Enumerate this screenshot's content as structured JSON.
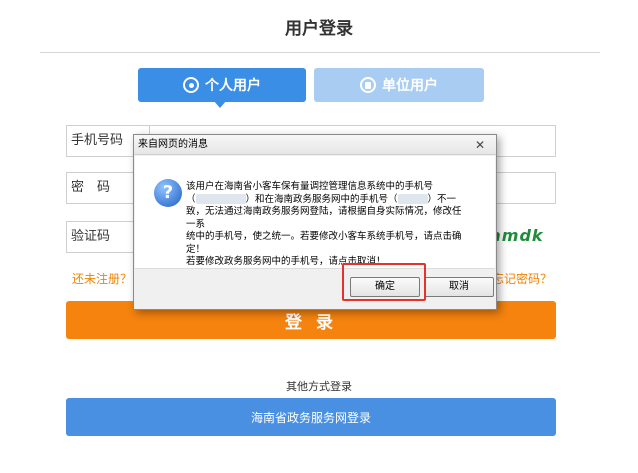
{
  "page": {
    "title": "用户登录"
  },
  "tabs": [
    {
      "label": "个人用户",
      "active": true,
      "icon": "user-icon"
    },
    {
      "label": "单位用户",
      "active": false,
      "icon": "building-icon"
    }
  ],
  "form": {
    "phone_label": "手机号码",
    "password_label": "密　码",
    "captcha_label": "验证码",
    "captcha_text": "amdk",
    "register_link": "还未注册？",
    "forgot_link": "忘记密码？",
    "login_button": "登 录"
  },
  "other_login": {
    "label": "其他方式登录",
    "gov_button": "海南省政务服务网登录"
  },
  "dialog": {
    "title": "来自网页的消息",
    "close": "✕",
    "message_line1": "该用户在海南省小客车保有量调控管理信息系统中的手机号",
    "message_line2a": "（",
    "message_line2b": "）和在海南政务服务网中的手机号（",
    "message_line2c": "）不一",
    "message_line3": "致，无法通过海南政务服务网登陆，请根据自身实际情况，修改任一系",
    "message_line4": "统中的手机号，使之统一。若要修改小客车系统手机号，请点击确定！",
    "message_line5": "若要修改政务服务网中的手机号，请点击取消！",
    "ok_button": "确定",
    "cancel_button": "取消"
  },
  "colors": {
    "primary_blue": "#3a8ee6",
    "inactive_tab": "#a9ccf2",
    "login_orange": "#f5830e",
    "link_orange": "#f08300",
    "gov_blue": "#4a90e2",
    "highlight_red": "#e5322d",
    "captcha_green": "#1d8c3b"
  }
}
